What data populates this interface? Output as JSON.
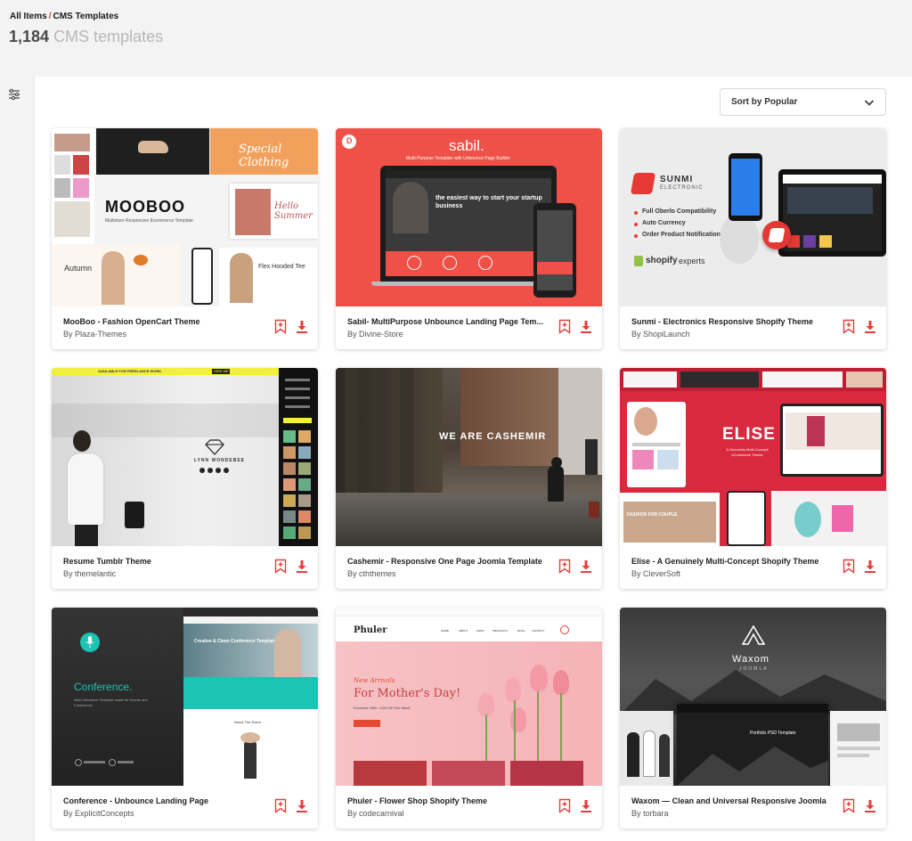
{
  "breadcrumb": {
    "root": "All Items",
    "separator": "/",
    "current": "CMS Templates"
  },
  "results": {
    "count": "1,184",
    "label": "CMS templates"
  },
  "sidebar": {
    "filter_icon": "sliders-icon"
  },
  "sort": {
    "label": "Sort by Popular",
    "icon": "chevron-down-icon"
  },
  "colors": {
    "accent": "#e53e3e",
    "header_bg": "#f3f3f3"
  },
  "cards": [
    {
      "title": "MooBoo - Fashion OpenCart Theme",
      "by": "By",
      "author": "Plaza-Themes",
      "thumb": {
        "brand": "MOOBOO",
        "tagline": "Multistore Responsive Ecommerce Template",
        "promo_1": "Special Clothing",
        "promo_2": "Hello Summer",
        "small_1": "Autumn",
        "small_2": "Flex Hooded Tee"
      }
    },
    {
      "title": "Sabil- MultiPurpose Unbounce Landing Page Tem...",
      "by": "By",
      "author": "Divine-Store",
      "thumb": {
        "brand": "sabil.",
        "subtitle": "Multi-Purpose Template with Unbounce Page Builder",
        "headline": "the easiest way to start your startup business",
        "logo_letter": "D"
      }
    },
    {
      "title": "Sunmi - Electronics Responsive Shopify Theme",
      "by": "By",
      "author": "ShopiLaunch",
      "thumb": {
        "brand": "SUNMI",
        "brand_sub": "ELECTRONIC",
        "features": [
          "Full Oberlo Compatibility",
          "Auto Currency",
          "Order Product Notification"
        ],
        "shopify_text": "shopify",
        "experts_text": "experts"
      }
    },
    {
      "title": "Resume Tumblr Theme",
      "by": "By",
      "author": "themelantic",
      "thumb": {
        "name": "LYNN WONDEBEE",
        "bar_text": "AVAILABLE FOR FREELANCE WORK",
        "bar_btn": "HIRE ME"
      }
    },
    {
      "title": "Cashemir - Responsive One Page Joomla Template",
      "by": "By",
      "author": "cththemes",
      "thumb": {
        "headline": "WE ARE CASHEMIR"
      }
    },
    {
      "title": "Elise - A Genuinely Multi-Concept Shopify Theme",
      "by": "By",
      "author": "CleverSoft",
      "thumb": {
        "brand": "ELISE",
        "subtitle": "A Genuinely Multi-Concept eCommerce Theme",
        "promo": "FASHION FOR COUPLE"
      }
    },
    {
      "title": "Conference - Unbounce Landing Page",
      "by": "By",
      "author": "ExplicitConcepts",
      "thumb": {
        "brand": "Conference.",
        "desc": "New Unbounce Template made for Events and Conference",
        "hero": "Creative & Clean Conference Template",
        "section": "About The Event"
      }
    },
    {
      "title": "Phuler - Flower Shop Shopify Theme",
      "by": "By",
      "author": "codecarnival",
      "thumb": {
        "brand": "Phuler",
        "kicker": "New Arrivals",
        "headline": "For Mother's Day!",
        "offer": "Exclusive Offer -10% Off This Week",
        "nav": [
          "HOME",
          "ABOUT",
          "SHOP",
          "PRODUCTS",
          "BLOG",
          "CONTACT"
        ]
      }
    },
    {
      "title": "Waxom — Clean and Universal Responsive Joomla",
      "by": "By",
      "author": "torbara",
      "thumb": {
        "brand": "Waxom",
        "brand_sub": "JOOMLA",
        "inner": "Portfolio PSD Template"
      }
    }
  ]
}
